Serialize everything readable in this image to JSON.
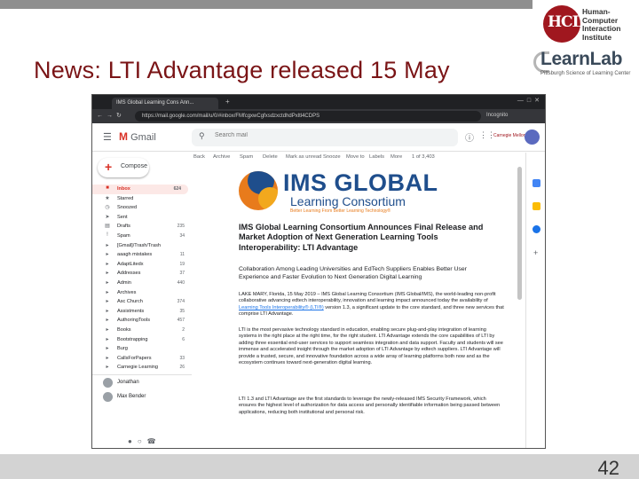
{
  "slide": {
    "title": "News: LTI Advantage released 15 May",
    "page_number": "42"
  },
  "logos": {
    "hcii_monogram": "HCII",
    "hcii_lines": [
      "Human-",
      "Computer",
      "Interaction",
      "Institute"
    ],
    "learnlab_name": "LearnLab",
    "learnlab_tagline": "Pittsburgh Science of Learning Center"
  },
  "browser": {
    "tab_title": "IMS Global Learning Cons Ann...",
    "url": "https://mail.google.com/mail/u/0/#inbox/FMfcgxwCgfxsdzxctdhdPxltl4CDPS",
    "profile_label": "Incognito"
  },
  "gmail": {
    "app_name": "Gmail",
    "search_placeholder": "Search mail",
    "org_label": "Carnegie Mellon",
    "compose_label": "Compose",
    "toolbar": [
      {
        "label": "Back",
        "icon": "arrow-back-icon"
      },
      {
        "label": "Archive",
        "icon": "archive-icon"
      },
      {
        "label": "Spam",
        "icon": "spam-icon"
      },
      {
        "label": "Delete",
        "icon": "trash-icon"
      },
      {
        "label": "Mark as unread",
        "icon": "mail-icon"
      },
      {
        "label": "Snooze",
        "icon": "clock-icon"
      },
      {
        "label": "Move to",
        "icon": "folder-icon"
      },
      {
        "label": "Labels",
        "icon": "label-icon"
      },
      {
        "label": "More",
        "icon": "more-icon"
      },
      {
        "label": "1 of 3,403",
        "icon": "pager-icon"
      }
    ],
    "labels": [
      {
        "name": "Inbox",
        "count": "624",
        "icon": "inbox-icon",
        "active": true
      },
      {
        "name": "Starred",
        "count": "",
        "icon": "star-icon"
      },
      {
        "name": "Snoozed",
        "count": "",
        "icon": "clock-icon"
      },
      {
        "name": "Sent",
        "count": "",
        "icon": "send-icon"
      },
      {
        "name": "Drafts",
        "count": "235",
        "icon": "draft-icon"
      },
      {
        "name": "Spam",
        "count": "34",
        "icon": "spam-icon"
      },
      {
        "name": "[Gmail]/Trash/Trash",
        "count": "",
        "icon": "label-icon"
      },
      {
        "name": "aaagh mistakes",
        "count": "11",
        "icon": "label-icon"
      },
      {
        "name": "AdaptLitedx",
        "count": "19",
        "icon": "label-icon"
      },
      {
        "name": "Addresses",
        "count": "37",
        "icon": "label-icon"
      },
      {
        "name": "Admin",
        "count": "440",
        "icon": "label-icon"
      },
      {
        "name": "Archives",
        "count": "",
        "icon": "label-icon"
      },
      {
        "name": "Asc Church",
        "count": "374",
        "icon": "label-icon"
      },
      {
        "name": "Assistments",
        "count": "35",
        "icon": "label-icon"
      },
      {
        "name": "AuthoringTools",
        "count": "457",
        "icon": "label-icon"
      },
      {
        "name": "Books",
        "count": "2",
        "icon": "label-icon"
      },
      {
        "name": "Bootstrapping",
        "count": "6",
        "icon": "label-icon"
      },
      {
        "name": "Burg",
        "count": "",
        "icon": "label-icon"
      },
      {
        "name": "CallsForPapers",
        "count": "33",
        "icon": "label-icon"
      },
      {
        "name": "Carnegie Learning",
        "count": "26",
        "icon": "label-icon"
      }
    ],
    "hangouts": [
      {
        "name": "Jonathan"
      },
      {
        "name": "Max Bender"
      }
    ],
    "email": {
      "brand_title": "IMS GLOBAL",
      "brand_subtitle": "Learning Consortium",
      "brand_tagline": "Better Learning From Better Learning Technology®",
      "headline": "IMS Global Learning Consortium Announces Final Release and Market Adoption of Next Generation Learning Tools Interoperability: LTI Advantage",
      "subhead": "Collaboration Among Leading Universities and EdTech Suppliers Enables Better User Experience and Faster Evolution to Next Generation Digital Learning",
      "para1_lead": "LAKE MARY, Florida, 15 May 2019 – IMS Global Learning Consortium (IMS Global/IMS), the world-leading non-profit collaborative advancing edtech interoperability, innovation and learning impact announced today the availability of ",
      "para1_link": "Learning Tools Interoperability® (LTI®)",
      "para1_tail": " version 1.3, a significant update to the core standard, and three new services that comprise LTI Advantage.",
      "para2": "LTI is the most pervasive technology standard in education, enabling secure plug-and-play integration of learning systems in the right place at the right time, for the right student. LTI Advantage extends the core capabilities of LTI by adding three essential end-user services to support seamless integration and data support. Faculty and students will see immense and accelerated insight through the market adoption of LTI Advantage by edtech suppliers. LTI Advantage will provide a trusted, secure, and innovative foundation across a wide array of learning platforms both now and as the ecosystem continues toward next-generation digital learning.",
      "para3": "LTI 1.3 and LTI Advantage are the first standards to leverage the newly-released IMS Security Framework, which ensures the highest level of authorization for data access and personally identifiable information being passed between applications, reducing both institutional and personal risk."
    }
  },
  "colors": {
    "title_red": "#7a1416",
    "gmail_red": "#d93025",
    "ims_blue": "#1f4e8c",
    "ims_orange": "#e87b1c"
  }
}
